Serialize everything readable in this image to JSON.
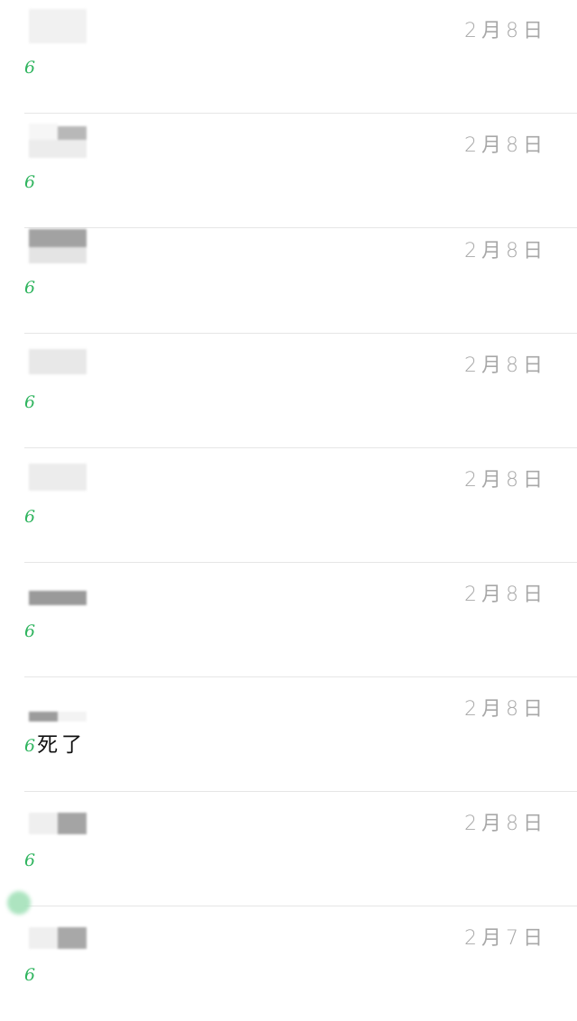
{
  "chat_list": {
    "items": [
      {
        "date": "2月8日",
        "message": "6",
        "extra": ""
      },
      {
        "date": "2月8日",
        "message": "6",
        "extra": ""
      },
      {
        "date": "2月8日",
        "message": "6",
        "extra": ""
      },
      {
        "date": "2月8日",
        "message": "6",
        "extra": ""
      },
      {
        "date": "2月8日",
        "message": "6",
        "extra": ""
      },
      {
        "date": "2月8日",
        "message": "6",
        "extra": ""
      },
      {
        "date": "2月8日",
        "message": "6",
        "extra": "死了"
      },
      {
        "date": "2月8日",
        "message": "6",
        "extra": ""
      },
      {
        "date": "2月7日",
        "message": "6",
        "extra": ""
      }
    ]
  },
  "colors": {
    "message_green": "#2fb45e",
    "date_gray": "#a8a8a8",
    "divider": "#e6e6e6"
  }
}
